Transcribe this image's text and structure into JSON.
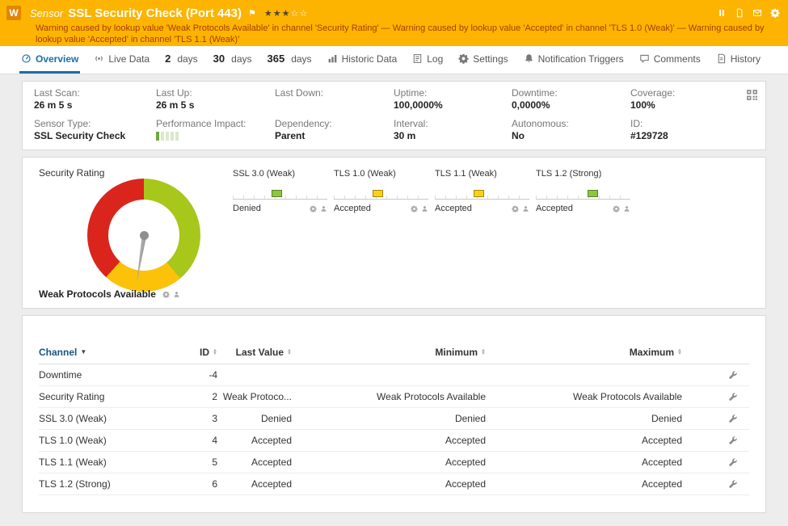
{
  "colors": {
    "header_bg": "#fcb400",
    "badge_bg": "#e08600",
    "accent_blue": "#1b6ea5",
    "warning_text": "#a83d00",
    "gauge_green": "#a7c71a",
    "gauge_yellow": "#fcc20a",
    "gauge_red": "#da251d",
    "status_green": "#8dc63f",
    "status_yellow": "#fdd017"
  },
  "header": {
    "badge": "W",
    "kind": "Sensor",
    "title": "SSL Security Check (Port 443)",
    "flag_icon": "⚑",
    "stars_filled": "★★★",
    "stars_empty": "☆☆",
    "icons": [
      "pause",
      "report",
      "mail",
      "settings"
    ],
    "warning": "Warning caused by lookup value 'Weak Protocols Available' in channel 'Security Rating' — Warning caused by lookup value 'Accepted' in channel 'TLS 1.0 (Weak)' — Warning caused by lookup value 'Accepted' in channel 'TLS 1.1 (Weak)'"
  },
  "tabs": [
    {
      "label": "Overview"
    },
    {
      "label": "Live Data"
    },
    {
      "num": "2",
      "label": "days"
    },
    {
      "num": "30",
      "label": "days"
    },
    {
      "num": "365",
      "label": "days"
    },
    {
      "label": "Historic Data"
    },
    {
      "label": "Log"
    },
    {
      "label": "Settings"
    },
    {
      "label": "Notification Triggers"
    },
    {
      "label": "Comments"
    },
    {
      "label": "History"
    }
  ],
  "info": {
    "row1": [
      {
        "label": "Last Scan:",
        "value": "26 m 5 s"
      },
      {
        "label": "Last Up:",
        "value": "26 m 5 s"
      },
      {
        "label": "Last Down:",
        "value": ""
      },
      {
        "label": "Uptime:",
        "value": "100,0000%"
      },
      {
        "label": "Downtime:",
        "value": "0,0000%"
      },
      {
        "label": "Coverage:",
        "value": "100%"
      }
    ],
    "row2": [
      {
        "label": "Sensor Type:",
        "value": "SSL Security Check"
      },
      {
        "label": "Performance Impact:",
        "value": ""
      },
      {
        "label": "Dependency:",
        "value": "Parent"
      },
      {
        "label": "Interval:",
        "value": "30 m"
      },
      {
        "label": "Autonomous:",
        "value": "No"
      },
      {
        "label": "ID:",
        "value": "#129728"
      }
    ]
  },
  "gauge": {
    "title": "Security Rating",
    "value": "Weak Protocols Available"
  },
  "mini_gauges": [
    {
      "title": "SSL 3.0 (Weak)",
      "value": "Denied",
      "marker_color": "#8dc63f",
      "marker_left": "46%"
    },
    {
      "title": "TLS 1.0 (Weak)",
      "value": "Accepted",
      "marker_color": "#fdd017",
      "marker_left": "46%"
    },
    {
      "title": "TLS 1.1 (Weak)",
      "value": "Accepted",
      "marker_color": "#fdd017",
      "marker_left": "46%"
    },
    {
      "title": "TLS 1.2 (Strong)",
      "value": "Accepted",
      "marker_color": "#8dc63f",
      "marker_left": "60%"
    }
  ],
  "table": {
    "sort_up": "▲",
    "sort_down": "▼",
    "headers": [
      "Channel",
      "ID",
      "Last Value",
      "Minimum",
      "Maximum"
    ],
    "rows": [
      {
        "channel": "Downtime",
        "id": "-4",
        "last": "",
        "min": "",
        "max": ""
      },
      {
        "channel": "Security Rating",
        "id": "2",
        "last": "Weak Protoco...",
        "min": "Weak Protocols Available",
        "max": "Weak Protocols Available"
      },
      {
        "channel": "SSL 3.0 (Weak)",
        "id": "3",
        "last": "Denied",
        "min": "Denied",
        "max": "Denied"
      },
      {
        "channel": "TLS 1.0 (Weak)",
        "id": "4",
        "last": "Accepted",
        "min": "Accepted",
        "max": "Accepted"
      },
      {
        "channel": "TLS 1.1 (Weak)",
        "id": "5",
        "last": "Accepted",
        "min": "Accepted",
        "max": "Accepted"
      },
      {
        "channel": "TLS 1.2 (Strong)",
        "id": "6",
        "last": "Accepted",
        "min": "Accepted",
        "max": "Accepted"
      }
    ]
  }
}
